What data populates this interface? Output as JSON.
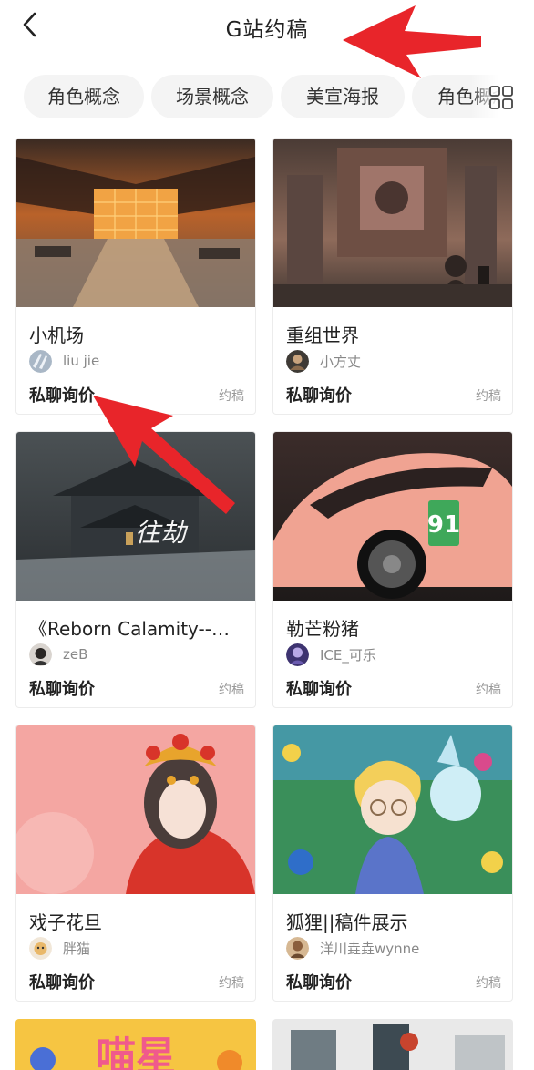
{
  "header": {
    "title": "G站约稿"
  },
  "categories": [
    {
      "label": "角色概念"
    },
    {
      "label": "场景概念"
    },
    {
      "label": "美宣海报"
    },
    {
      "label": "角色概念"
    }
  ],
  "cards": [
    {
      "title": "小机场",
      "author": "liu jie",
      "price": "私聊询价",
      "tag": "约稿"
    },
    {
      "title": "重组世界",
      "author": "小方丈",
      "price": "私聊询价",
      "tag": "约稿"
    },
    {
      "title": "《Reborn Calamity--往…",
      "author": "zeB",
      "price": "私聊询价",
      "tag": "约稿",
      "artwork_text": "往劫"
    },
    {
      "title": "勒芒粉猪",
      "author": "ICE_可乐",
      "price": "私聊询价",
      "tag": "约稿",
      "artwork_text": "91"
    },
    {
      "title": "戏子花旦",
      "author": "胖猫",
      "price": "私聊询价",
      "tag": "约稿"
    },
    {
      "title": "狐狸||稿件展示",
      "author": "洋川垚垚wynne",
      "price": "私聊询价",
      "tag": "约稿"
    }
  ],
  "partial_cards": [
    {
      "artwork_text": "喵星"
    },
    {
      "artwork_text": ""
    }
  ],
  "icons": {
    "back": "chevron-left-icon",
    "grid": "grid-icon",
    "annotation": "red-arrow"
  },
  "colors": {
    "annotation_arrow": "#e8252a",
    "chip_background": "#f4f4f4"
  }
}
